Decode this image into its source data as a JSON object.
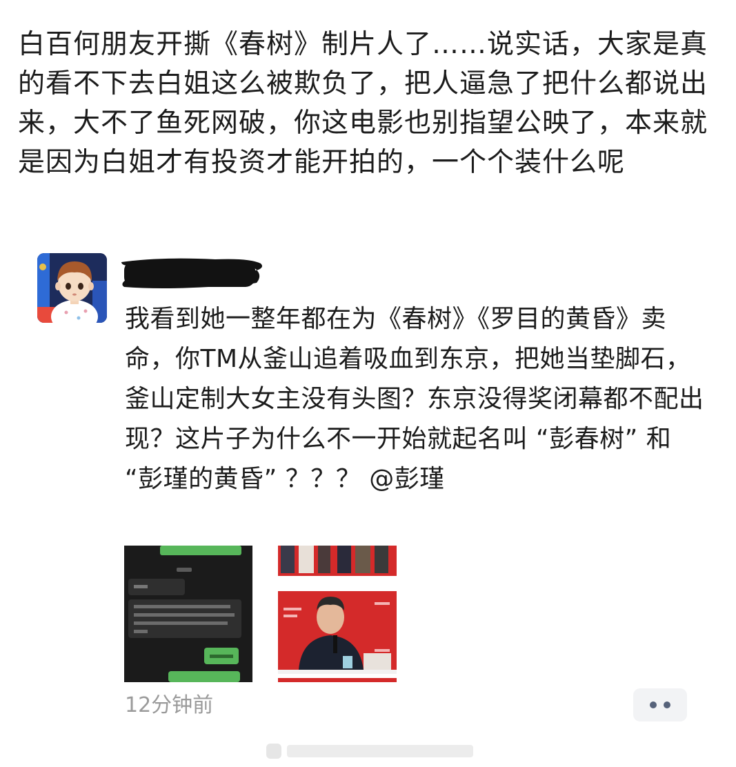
{
  "post": {
    "text": "白百何朋友开撕《春树》制片人了……说实话，大家是真的看不下去白姐这么被欺负了，把人逼急了把什么都说出来，大不了鱼死网破，你这电影也别指望公映了，本来就是因为白姐才有投资才能开拍的，一个个装什么呢"
  },
  "comment": {
    "text": "我看到她一整年都在为《春树》《罗目的黄昏》卖命，你TM从釜山追着吸血到东京，把她当垫脚石，釜山定制大女主没有头图？东京没得奖闭幕都不配出现？这片子为什么不一开始就起名叫 “彭春树” 和 “彭瑾的黄昏” ？？？ ",
    "mention": "@彭瑾",
    "timestamp": "12分钟前"
  },
  "colors": {
    "text": "#1c1c1c",
    "muted": "#9a9a9a",
    "chat_green": "#57b65a",
    "red_backdrop": "#d42a2a"
  }
}
